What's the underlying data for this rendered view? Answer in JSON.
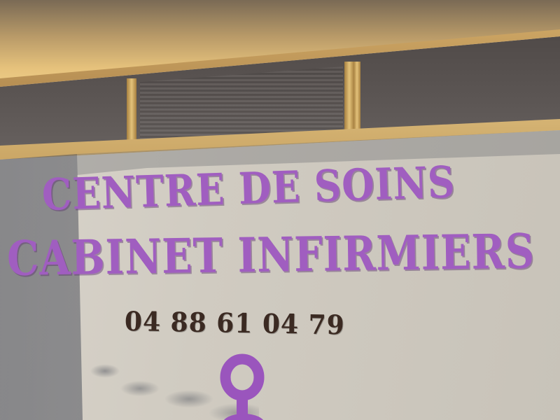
{
  "sign": {
    "line1": "CENTRE DE SOINS",
    "line2": "CABINET INFIRMIERS",
    "phone": "04 88 61 04 79"
  },
  "colors": {
    "lettering": "#a05ec0",
    "phone_text": "#3b2a22",
    "panel": "#d0cbc1",
    "frame": "#e3c27a"
  },
  "emblem": {
    "icon": "purple-ring-icon"
  }
}
